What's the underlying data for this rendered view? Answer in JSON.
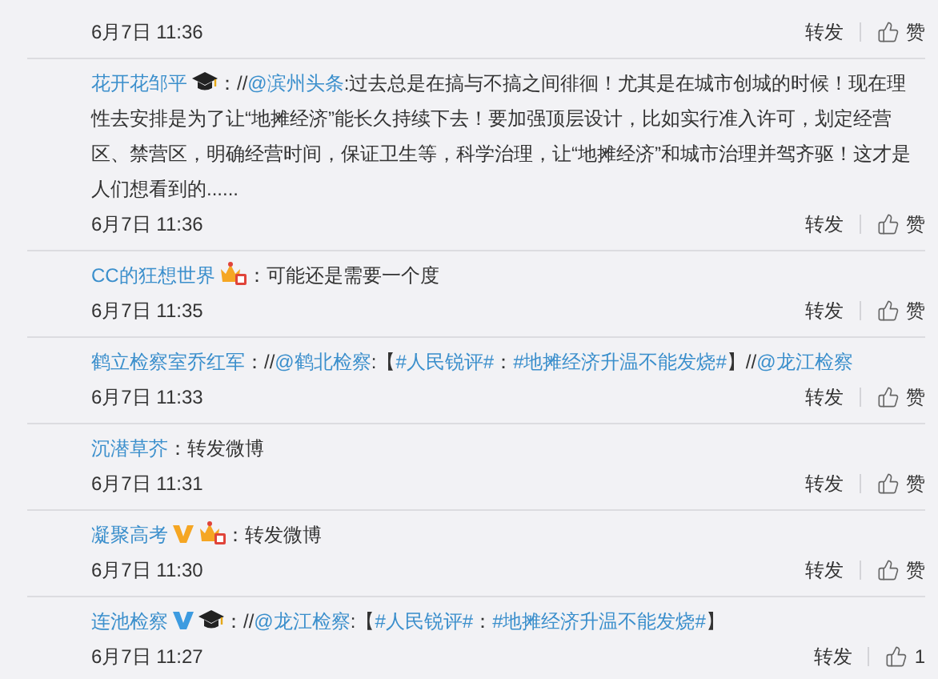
{
  "comments": [
    {
      "time": "6月7日 11:36",
      "repost": "转发",
      "like": "赞"
    },
    {
      "user": "花开花邹平",
      "badges": [
        {
          "kind": "cap"
        }
      ],
      "segments": [
        {
          "kind": "text",
          "text": "：//"
        },
        {
          "kind": "mention",
          "text": "@滨州头条"
        },
        {
          "kind": "text",
          "text": ":过去总是在搞与不搞之间徘徊！尤其是在城市创城的时候！现在理性去安排是为了让“地摊经济”能长久持续下去！要加强顶层设计，比如实行准入许可，划定经营区、禁营区，明确经营时间，保证卫生等，科学治理，让“地摊经济”和城市治理并驾齐驱！这才是人们想看到的......"
        }
      ],
      "time": "6月7日 11:36",
      "repost": "转发",
      "like": "赞"
    },
    {
      "user": "CC的狂想世界",
      "badges": [
        {
          "kind": "vip"
        }
      ],
      "segments": [
        {
          "kind": "text",
          "text": "：可能还是需要一个度"
        }
      ],
      "time": "6月7日 11:35",
      "repost": "转发",
      "like": "赞"
    },
    {
      "user": "鹤立检察室乔红军",
      "segments": [
        {
          "kind": "text",
          "text": "：//"
        },
        {
          "kind": "mention",
          "text": "@鹤北检察"
        },
        {
          "kind": "text",
          "text": ":【"
        },
        {
          "kind": "topic",
          "text": "#人民锐评#"
        },
        {
          "kind": "text",
          "text": "："
        },
        {
          "kind": "topic",
          "text": "#地摊经济升温不能发烧#"
        },
        {
          "kind": "text",
          "text": "】//"
        },
        {
          "kind": "mention",
          "text": "@龙江检察"
        }
      ],
      "time": "6月7日 11:33",
      "repost": "转发",
      "like": "赞"
    },
    {
      "user": "沉潜草芥",
      "segments": [
        {
          "kind": "text",
          "text": "：转发微博"
        }
      ],
      "time": "6月7日 11:31",
      "repost": "转发",
      "like": "赞"
    },
    {
      "user": "凝聚高考",
      "badges": [
        {
          "kind": "verified",
          "color": "#f5a623"
        },
        {
          "kind": "vip"
        }
      ],
      "segments": [
        {
          "kind": "text",
          "text": "：转发微博"
        }
      ],
      "time": "6月7日 11:30",
      "repost": "转发",
      "like": "赞"
    },
    {
      "user": "连池检察",
      "badges": [
        {
          "kind": "verified",
          "color": "#3d9be0"
        },
        {
          "kind": "cap"
        }
      ],
      "segments": [
        {
          "kind": "text",
          "text": "：//"
        },
        {
          "kind": "mention",
          "text": "@龙江检察"
        },
        {
          "kind": "text",
          "text": ":【"
        },
        {
          "kind": "topic",
          "text": "#人民锐评#"
        },
        {
          "kind": "text",
          "text": "："
        },
        {
          "kind": "topic",
          "text": "#地摊经济升温不能发烧#"
        },
        {
          "kind": "text",
          "text": "】"
        }
      ],
      "time": "6月7日 11:27",
      "repost": "转发",
      "like": "1"
    }
  ]
}
